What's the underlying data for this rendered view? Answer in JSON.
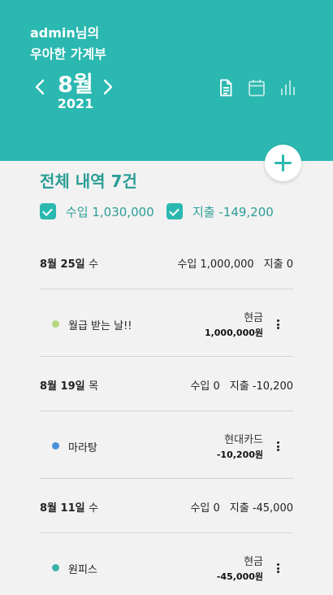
{
  "header": {
    "greeting_line1": "admin님의",
    "greeting_line2": "우아한 가계부",
    "month": "8월",
    "year": "2021",
    "bg_color": "#2bb8b0",
    "icons": [
      "document-icon",
      "calendar-icon",
      "bar-chart-icon"
    ]
  },
  "summary": {
    "total_label": "전체 내역 7건",
    "income_filter": "수입 1,030,000",
    "expense_filter": "지출 -149,200",
    "income_checked": true,
    "expense_checked": true
  },
  "groups": [
    {
      "date": "8월 25일",
      "day": "수",
      "income": "수입 1,000,000",
      "expense": "지출 0",
      "items": [
        {
          "name": "월급 받는 날!!",
          "payment": "현금",
          "amount": "1,000,000원",
          "dot_color": "#b5d77f"
        }
      ]
    },
    {
      "date": "8월 19일",
      "day": "목",
      "income": "수입 0",
      "expense": "지출 -10,200",
      "items": [
        {
          "name": "마라탕",
          "payment": "현대카드",
          "amount": "-10,200원",
          "dot_color": "#4a90d9"
        }
      ]
    },
    {
      "date": "8월 11일",
      "day": "수",
      "income": "수입 0",
      "expense": "지출 -45,000",
      "items": [
        {
          "name": "원피스",
          "payment": "현금",
          "amount": "-45,000원",
          "dot_color": "#3db2ad"
        }
      ]
    }
  ],
  "colors": {
    "accent": "#2bb8b0",
    "accent_text": "#2a9d96"
  }
}
